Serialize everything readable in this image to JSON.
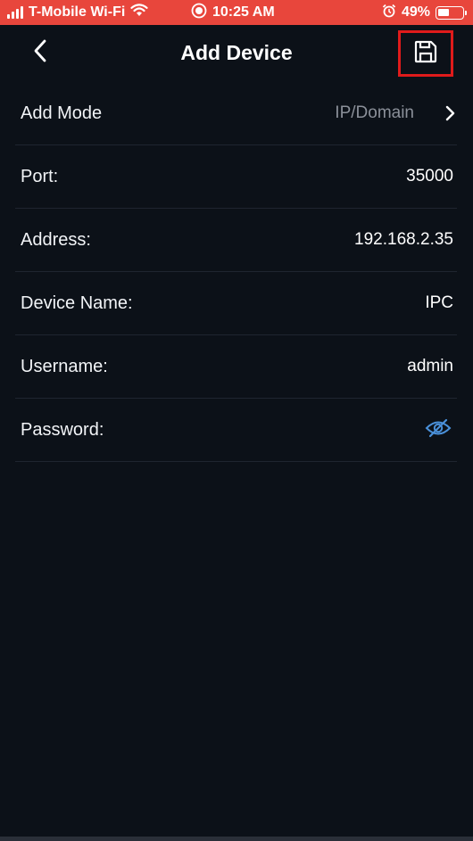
{
  "status_bar": {
    "carrier": "T-Mobile Wi-Fi",
    "time": "10:25 AM",
    "battery_percent": "49%",
    "battery_level": 0.49,
    "icons": [
      "signal-icon",
      "wifi-icon",
      "recording-icon",
      "alarm-icon",
      "battery-icon"
    ],
    "background_color": "#e8463c"
  },
  "header": {
    "title": "Add Device",
    "back_icon": "chevron-left-icon",
    "save_icon": "floppy-disk-icon",
    "highlight_color": "#e01b1b"
  },
  "form": {
    "add_mode": {
      "label": "Add Mode",
      "value": "IP/Domain"
    },
    "port": {
      "label": "Port:",
      "value": "35000"
    },
    "address": {
      "label": "Address:",
      "value": "192.168.2.35"
    },
    "device_name": {
      "label": "Device Name:",
      "value": "IPC"
    },
    "username": {
      "label": "Username:",
      "value": "admin"
    },
    "password": {
      "label": "Password:",
      "icon": "eye-off-icon",
      "icon_color": "#4a90d9"
    }
  }
}
